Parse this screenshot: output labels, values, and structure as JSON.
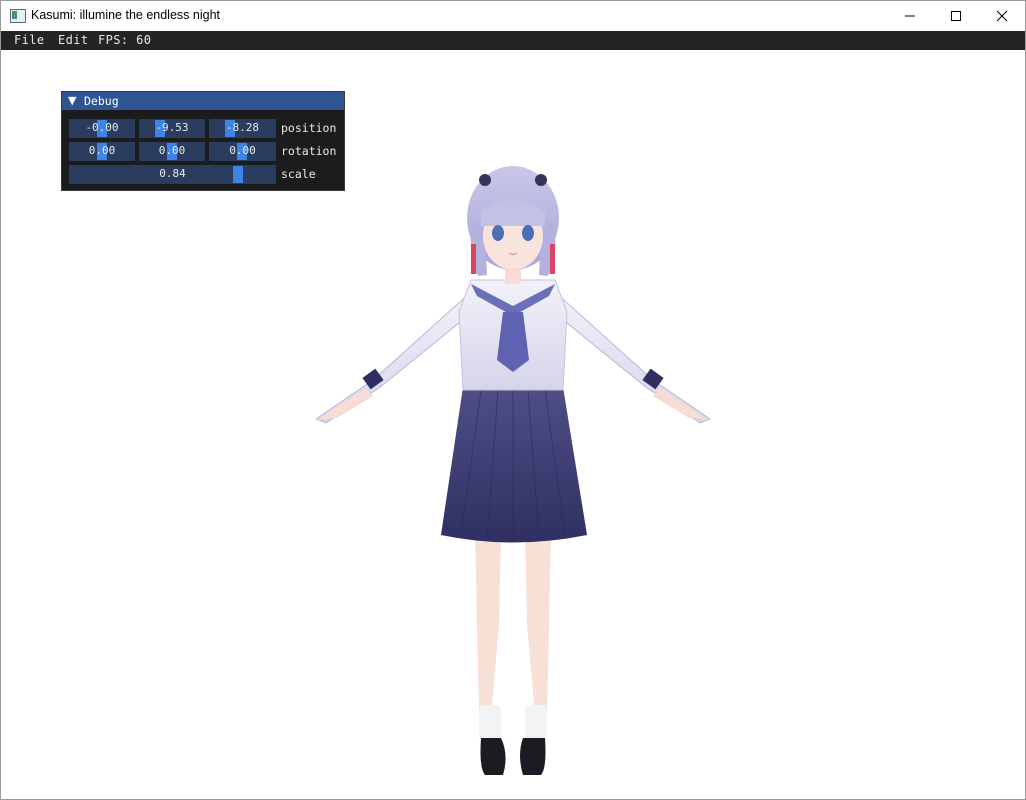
{
  "window": {
    "title": "Kasumi: illumine the endless night"
  },
  "menu": {
    "file": "File",
    "edit": "Edit",
    "fps": "FPS: 60"
  },
  "debug": {
    "title": "Debug",
    "position": {
      "label": "position",
      "x": "-0.00",
      "y": "-9.53",
      "z": "-8.28"
    },
    "rotation": {
      "label": "rotation",
      "x": "0.00",
      "y": "0.00",
      "z": "0.00"
    },
    "scale": {
      "label": "scale",
      "value": "0.84"
    }
  },
  "colors": {
    "menubar": "#242424",
    "debug_header": "#2e5591",
    "field": "#2a3d5e",
    "grab": "#3d84e6"
  }
}
